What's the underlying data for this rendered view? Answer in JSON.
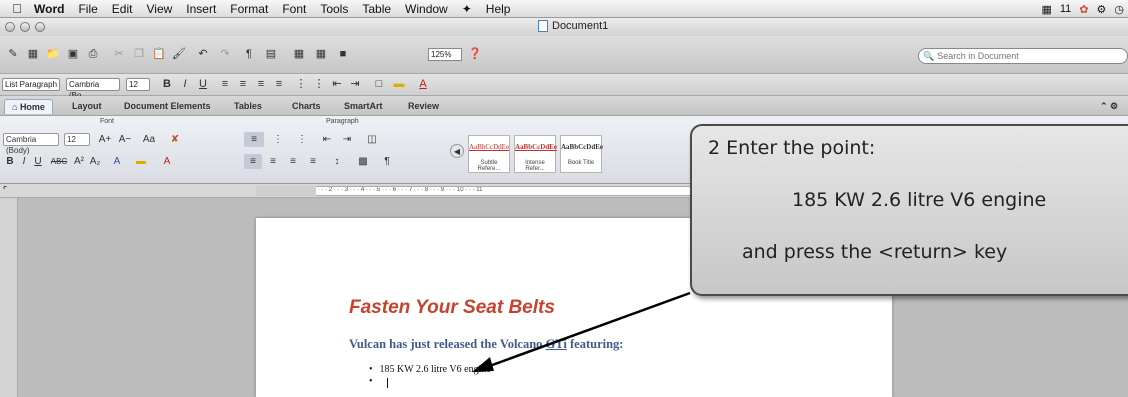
{
  "menubar": {
    "app": "Word",
    "items": [
      "File",
      "Edit",
      "View",
      "Insert",
      "Format",
      "Font",
      "Tools",
      "Table",
      "Window"
    ],
    "script_icon": "script-menu-icon",
    "help": "Help",
    "status_text": "11"
  },
  "window": {
    "title": "Document1"
  },
  "toolbar": {
    "zoom": "125%",
    "search_placeholder": "Search in Document"
  },
  "formatting": {
    "style": "List Paragraph",
    "font": "Cambria (Bo...",
    "size": "12",
    "bold": "B",
    "italic": "I",
    "underline": "U"
  },
  "ribbon_tabs": [
    "Home",
    "Layout",
    "Document Elements",
    "Tables",
    "Charts",
    "SmartArt",
    "Review"
  ],
  "ribbon": {
    "font_group": "Font",
    "paragraph_group": "Paragraph",
    "font_name": "Cambria (Body)",
    "font_size": "12",
    "styles": [
      {
        "sample": "AaBbCcDdEe",
        "name": "Subtle Refere..."
      },
      {
        "sample": "AaBbCcDdEe",
        "name": "Intense Refer..."
      },
      {
        "sample": "AaBbCcDdEe",
        "name": "Book Title"
      }
    ]
  },
  "ruler": {
    "marks": "3 · · · 2 · · · 1 · · · ⁸ · 1 · · · 2 · · · 3 · · · 4 · · · 5 · · · 6 · · · 7 · · · 8 · · · 9 · · · 10 · · · 11"
  },
  "document": {
    "heading": "Fasten Your Seat Belts",
    "subheading_pre": "Vulcan has just released the Volcano ",
    "subheading_gti": "GTi",
    "subheading_post": " featuring:",
    "bullets": [
      "185 KW 2.6 litre V6 engine",
      ""
    ]
  },
  "callout": {
    "step": "2",
    "line1": "Enter the point:",
    "line2": "185 KW 2.6 litre V6 engine",
    "line3": "and press the <return> key"
  }
}
